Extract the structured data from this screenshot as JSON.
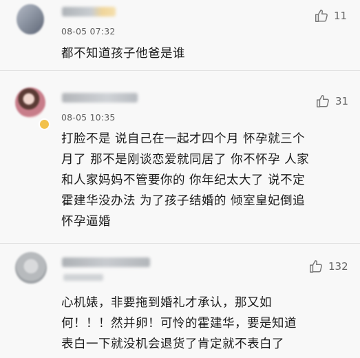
{
  "comments": [
    {
      "time": "08-05 07:32",
      "likes": "11",
      "text": "都不知道孩子他爸是谁"
    },
    {
      "time": "08-05 10:35",
      "likes": "31",
      "text": "打脸不是 说自己在一起才四个月 怀孕就三个\n月了 那不是刚谈恋爱就同居了 你不怀孕 人家\n和人家妈妈不管要你的 你年纪太大了 说不定\n霍建华没办法 为了孩子结婚的 倾室皇妃倒追\n怀孕逼婚"
    },
    {
      "time": "",
      "likes": "132",
      "text": "心机婊，非要拖到婚礼才承认，那又如\n何！！！然并卵！可怜的霍建华，要是知道\n表白一下就没机会退货了肯定就不表白了"
    }
  ],
  "colors": {
    "background": "#f8f8f8",
    "divider": "#e1e1e1",
    "text": "#1b1b1b",
    "meta": "#5f5f5f",
    "badge": "#f2c14b"
  },
  "icons": {
    "like": "thumbs-up-icon",
    "verified": "badge-icon"
  }
}
